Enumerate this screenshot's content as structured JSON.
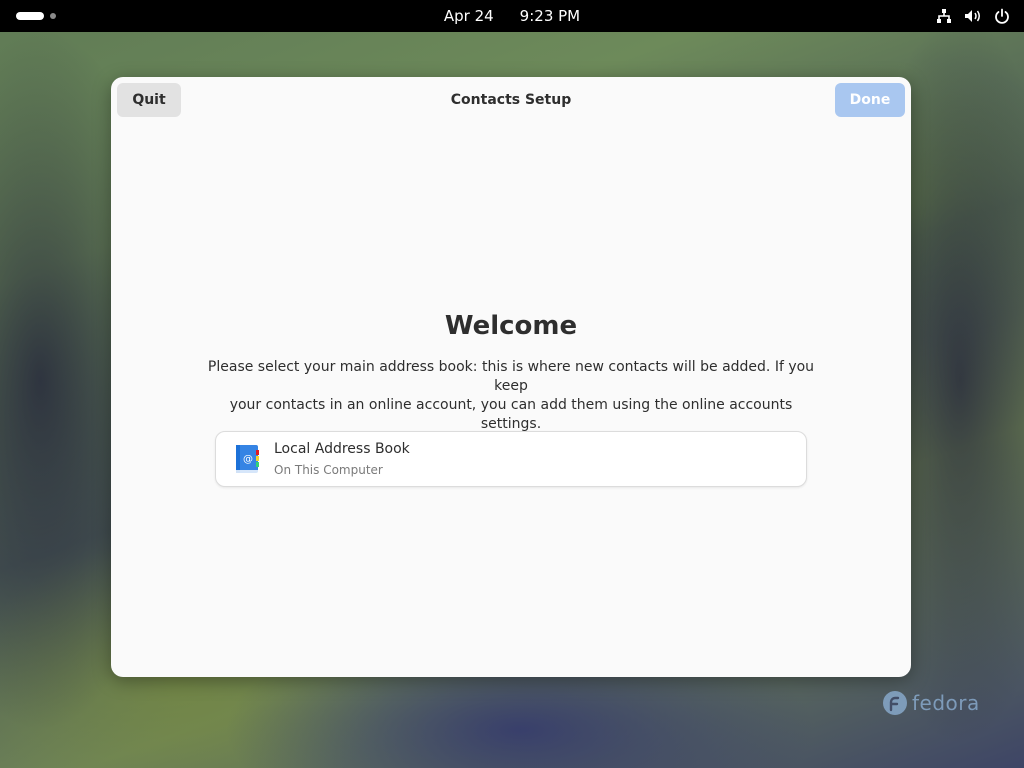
{
  "topbar": {
    "date": "Apr 24",
    "time": "9:23 PM",
    "icons": [
      "network-icon",
      "volume-icon",
      "power-icon"
    ]
  },
  "dialog": {
    "title": "Contacts Setup",
    "quit_label": "Quit",
    "done_label": "Done",
    "heading": "Welcome",
    "description_line1": "Please select your main address book: this is where new contacts will be added. If you keep",
    "description_line2": "your contacts in an online account, you can add them using the online accounts settings.",
    "address_books": [
      {
        "title": "Local Address Book",
        "subtitle": "On This Computer",
        "icon": "address-book-icon"
      }
    ]
  },
  "desktop": {
    "logo_text": "fedora"
  },
  "colors": {
    "accent": "#a9c7f0",
    "dialog_bg": "#fafafa",
    "topbar_bg": "#000000"
  }
}
